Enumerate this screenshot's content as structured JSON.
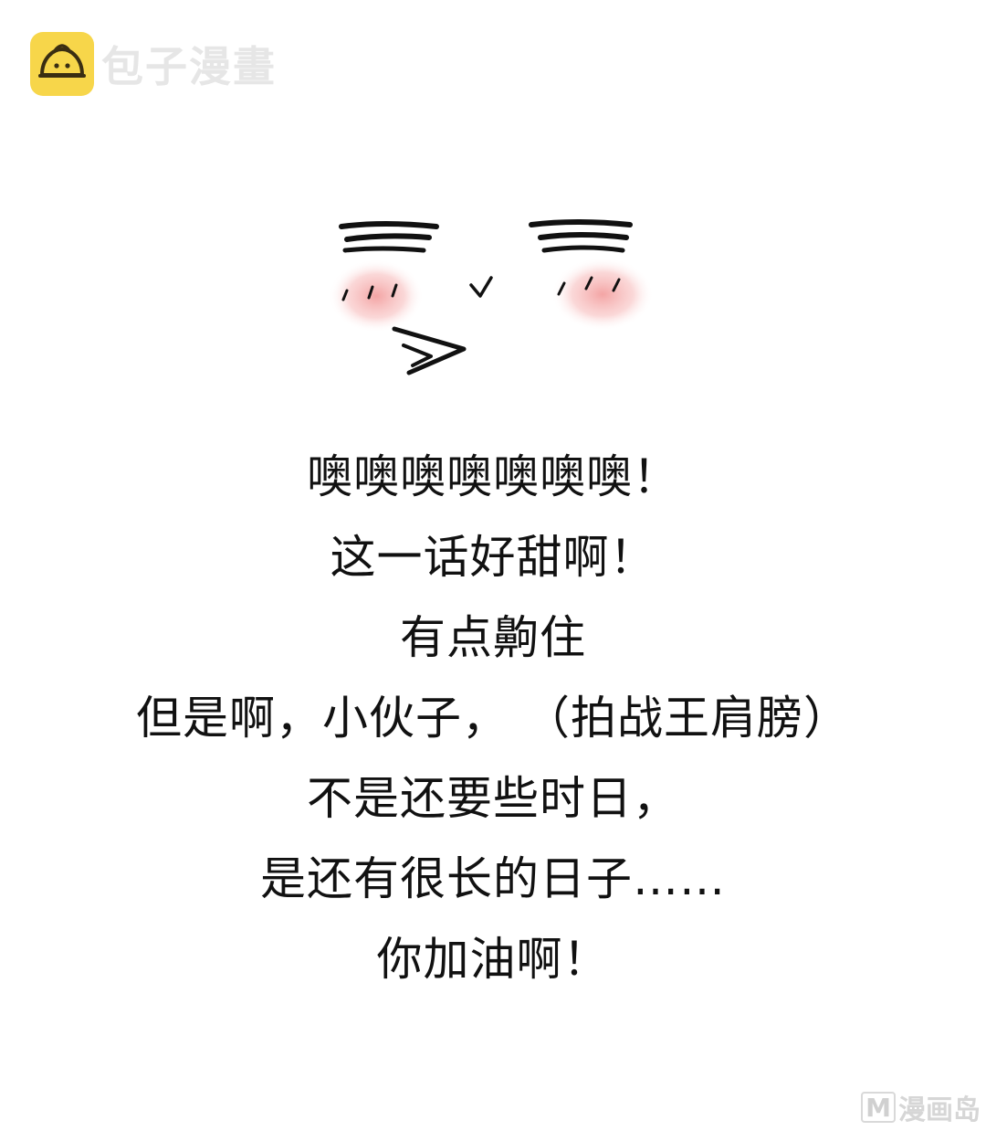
{
  "watermark_top": {
    "brand_name": "包子漫畫",
    "logo_icon": "steamed-bun-icon",
    "logo_color": "#f7d64a"
  },
  "illustration": {
    "icon": "blushing-face-icon",
    "blush_color": "#f5a0a0"
  },
  "message": {
    "lines": [
      "噢噢噢噢噢噢噢！",
      "这一话好甜啊！",
      "有点齁住",
      "但是啊，小伙子，  （拍战王肩膀）",
      "不是还要些时日，",
      "是还有很长的日子……",
      "你加油啊！"
    ]
  },
  "watermark_bottom": {
    "badge_letter": "M",
    "site_name": "漫画岛"
  }
}
